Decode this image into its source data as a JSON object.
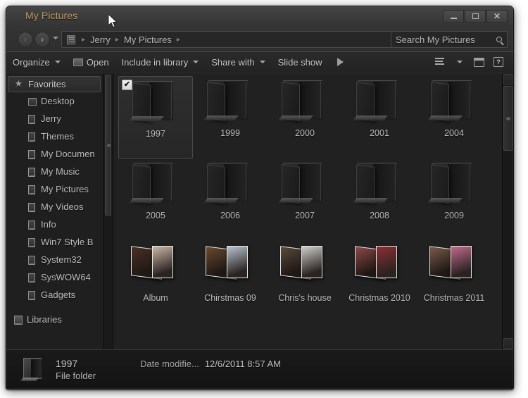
{
  "window": {
    "title": "My Pictures",
    "controls": {
      "minimize": "minimize-button",
      "maximize": "maximize-button",
      "close": "close-button"
    }
  },
  "address_bar": {
    "back_label": "‹",
    "forward_label": "›",
    "crumbs": [
      "Jerry",
      "My Pictures"
    ],
    "separator": "▸",
    "refresh_label": "✳"
  },
  "search": {
    "placeholder": "Search My Pictures",
    "value": "Search My Pictures"
  },
  "toolbar": {
    "organize": "Organize",
    "open": "Open",
    "include_in_library": "Include in library",
    "share_with": "Share with",
    "slide_show": "Slide show",
    "view_icon": "view-options-icon",
    "preview_pane_icon": "preview-pane-icon",
    "help_icon": "help-icon"
  },
  "navigation": {
    "favorites_label": "Favorites",
    "favorites": [
      {
        "label": "Desktop",
        "icon": "desktop-icon"
      },
      {
        "label": "Jerry",
        "icon": "folder-icon"
      },
      {
        "label": "Themes",
        "icon": "folder-icon"
      },
      {
        "label": "My Documen",
        "icon": "documents-folder-icon"
      },
      {
        "label": "My Music",
        "icon": "music-folder-icon"
      },
      {
        "label": "My Pictures",
        "icon": "pictures-folder-icon"
      },
      {
        "label": "My Videos",
        "icon": "videos-folder-icon"
      },
      {
        "label": "Info",
        "icon": "folder-icon"
      },
      {
        "label": "Win7 Style B",
        "icon": "folder-icon"
      },
      {
        "label": "System32",
        "icon": "folder-icon"
      },
      {
        "label": "SysWOW64",
        "icon": "folder-icon"
      },
      {
        "label": "Gadgets",
        "icon": "folder-icon"
      }
    ],
    "libraries_label": "Libraries"
  },
  "files": [
    {
      "name": "1997",
      "kind": "folder",
      "selected": true
    },
    {
      "name": "1999",
      "kind": "folder",
      "selected": false
    },
    {
      "name": "2000",
      "kind": "folder",
      "selected": false
    },
    {
      "name": "2001",
      "kind": "folder",
      "selected": false
    },
    {
      "name": "2004",
      "kind": "folder",
      "selected": false
    },
    {
      "name": "2005",
      "kind": "folder",
      "selected": false
    },
    {
      "name": "2006",
      "kind": "folder",
      "selected": false
    },
    {
      "name": "2007",
      "kind": "folder",
      "selected": false
    },
    {
      "name": "2008",
      "kind": "folder",
      "selected": false
    },
    {
      "name": "2009",
      "kind": "folder",
      "selected": false
    },
    {
      "name": "Album",
      "kind": "photo-folder",
      "selected": false,
      "photo_a": "#c9b7a6",
      "photo_b": "#4a2f28"
    },
    {
      "name": "Chirstmas 09",
      "kind": "photo-folder",
      "selected": false,
      "photo_a": "#b8c3cf",
      "photo_b": "#6b4a2e"
    },
    {
      "name": "Chris's house",
      "kind": "photo-folder",
      "selected": false,
      "photo_a": "#cfcfcb",
      "photo_b": "#5a4a3c"
    },
    {
      "name": "Christmas 2010",
      "kind": "photo-folder",
      "selected": false,
      "photo_a": "#8c2f33",
      "photo_b": "#8e4848"
    },
    {
      "name": "Christmas 2011",
      "kind": "photo-folder",
      "selected": false,
      "photo_a": "#c06a8c",
      "photo_b": "#7a5a4c"
    }
  ],
  "details": {
    "name": "1997",
    "date_label": "Date modifie...",
    "date_value": "12/6/2011 8:57 AM",
    "type": "File folder"
  },
  "checkbox_glyph": "✔",
  "colors": {
    "title_text": "#c39a62",
    "window_bg": "#1f1f1f",
    "body_text": "#bcbcbc"
  }
}
